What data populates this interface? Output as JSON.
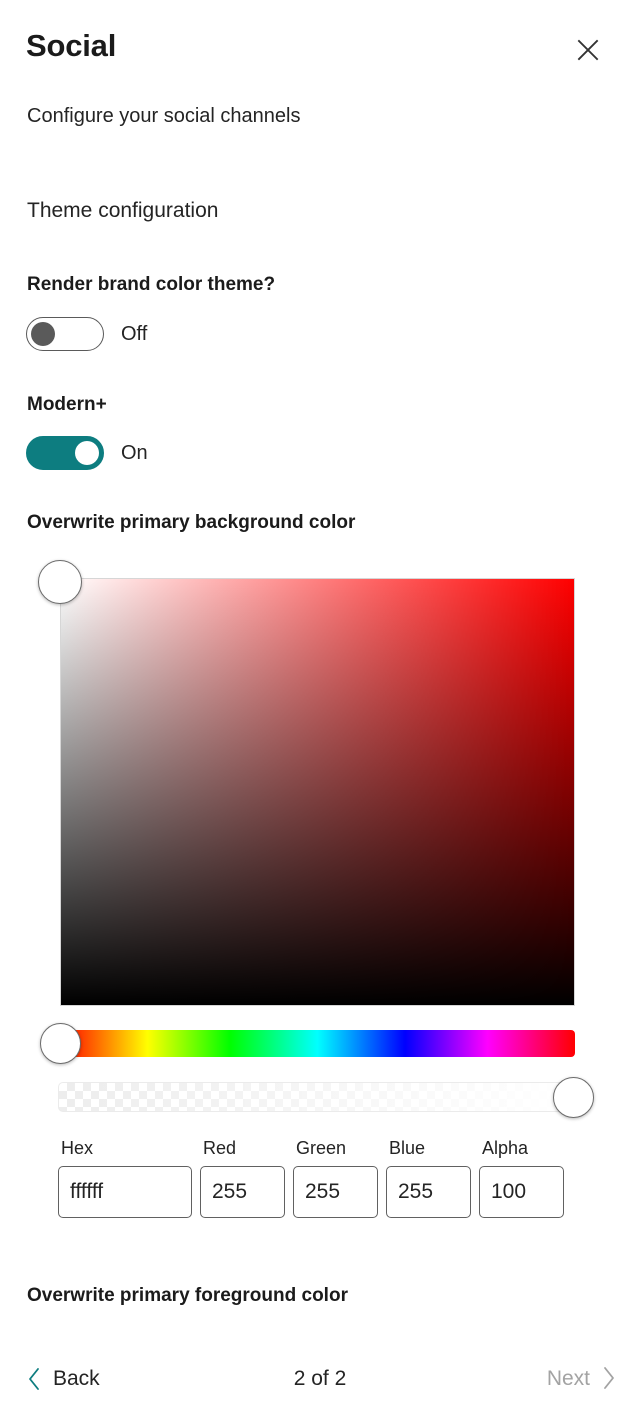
{
  "header": {
    "title": "Social",
    "subtitle": "Configure your social channels",
    "close_icon": "close-icon"
  },
  "section": {
    "heading": "Theme configuration"
  },
  "fields": {
    "brand_theme": {
      "label": "Render brand color theme?",
      "state_label": "Off",
      "checked": false
    },
    "modern_plus": {
      "label": "Modern+",
      "state_label": "On",
      "checked": true
    },
    "background_color": {
      "label": "Overwrite primary background color"
    },
    "foreground_color": {
      "label": "Overwrite primary foreground color"
    }
  },
  "color_picker": {
    "inputs": [
      {
        "caption": "Hex",
        "value": "ffffff"
      },
      {
        "caption": "Red",
        "value": "255"
      },
      {
        "caption": "Green",
        "value": "255"
      },
      {
        "caption": "Blue",
        "value": "255"
      },
      {
        "caption": "Alpha",
        "value": "100"
      }
    ]
  },
  "footer": {
    "back_label": "Back",
    "counter": "2 of 2",
    "next_label": "Next",
    "back_icon": "chevron-left-icon",
    "next_icon": "chevron-right-icon"
  },
  "colors": {
    "accent_teal": "#0d7d80",
    "text_primary": "#242424",
    "text_disabled": "#a3a3a3",
    "toggle_off": "#5a5a5a"
  }
}
